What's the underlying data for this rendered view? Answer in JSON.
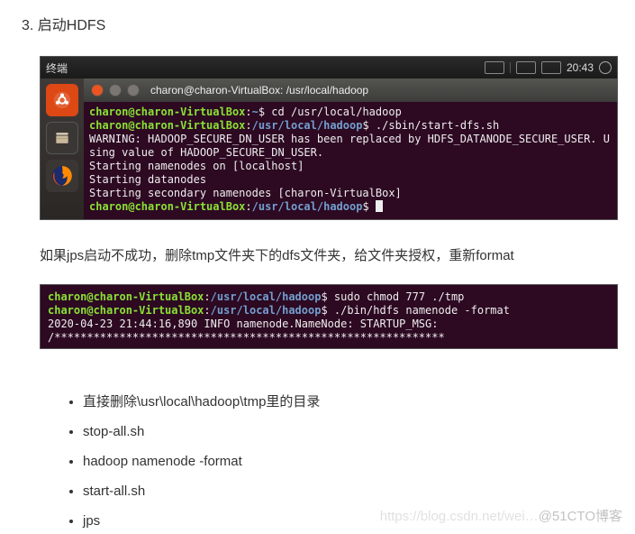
{
  "heading": "3. 启动HDFS",
  "shot1": {
    "topbar_left": "终端",
    "time": "20:43",
    "title": "charon@charon-VirtualBox: /usr/local/hadoop",
    "lines": [
      [
        {
          "cls": "t-green",
          "txt": "charon@charon-VirtualBox"
        },
        {
          "cls": "t-white",
          "txt": ":"
        },
        {
          "cls": "t-blue",
          "txt": "~"
        },
        {
          "cls": "t-white",
          "txt": "$ cd /usr/local/hadoop"
        }
      ],
      [
        {
          "cls": "t-green",
          "txt": "charon@charon-VirtualBox"
        },
        {
          "cls": "t-white",
          "txt": ":"
        },
        {
          "cls": "t-blue",
          "txt": "/usr/local/hadoop"
        },
        {
          "cls": "t-white",
          "txt": "$ ./sbin/start-dfs.sh"
        }
      ],
      [
        {
          "cls": "t-white",
          "txt": "WARNING: HADOOP_SECURE_DN_USER has been replaced by HDFS_DATANODE_SECURE_USER. U"
        }
      ],
      [
        {
          "cls": "t-white",
          "txt": "sing value of HADOOP_SECURE_DN_USER."
        }
      ],
      [
        {
          "cls": "t-white",
          "txt": "Starting namenodes on [localhost]"
        }
      ],
      [
        {
          "cls": "t-white",
          "txt": "Starting datanodes"
        }
      ],
      [
        {
          "cls": "t-white",
          "txt": "Starting secondary namenodes [charon-VirtualBox]"
        }
      ],
      [
        {
          "cls": "t-green",
          "txt": "charon@charon-VirtualBox"
        },
        {
          "cls": "t-white",
          "txt": ":"
        },
        {
          "cls": "t-blue",
          "txt": "/usr/local/hadoop"
        },
        {
          "cls": "t-white",
          "txt": "$ "
        },
        {
          "cls": "cursor",
          "txt": ""
        }
      ]
    ]
  },
  "para": "如果jps启动不成功，删除tmp文件夹下的dfs文件夹，给文件夹授权，重新format",
  "shot2": {
    "lines": [
      [
        {
          "cls": "t-green",
          "txt": "charon@charon-VirtualBox"
        },
        {
          "cls": "t-white",
          "txt": ":"
        },
        {
          "cls": "t-blue",
          "txt": "/usr/local/hadoop"
        },
        {
          "cls": "t-white",
          "txt": "$ sudo chmod 777 ./tmp"
        }
      ],
      [
        {
          "cls": "t-green",
          "txt": "charon@charon-VirtualBox"
        },
        {
          "cls": "t-white",
          "txt": ":"
        },
        {
          "cls": "t-blue",
          "txt": "/usr/local/hadoop"
        },
        {
          "cls": "t-white",
          "txt": "$ ./bin/hdfs namenode -format"
        }
      ],
      [
        {
          "cls": "t-white",
          "txt": "2020-04-23 21:44:16,890 INFO namenode.NameNode: STARTUP_MSG:"
        }
      ],
      [
        {
          "cls": "t-white",
          "txt": "/************************************************************"
        }
      ]
    ]
  },
  "bullets": [
    "直接删除\\usr\\local\\hadoop\\tmp里的目录",
    "stop-all.sh",
    "hadoop namenode -format",
    "start-all.sh",
    "jps"
  ],
  "watermark_faint": "https://blog.csdn.net/wei…",
  "watermark": "@51CTO博客"
}
